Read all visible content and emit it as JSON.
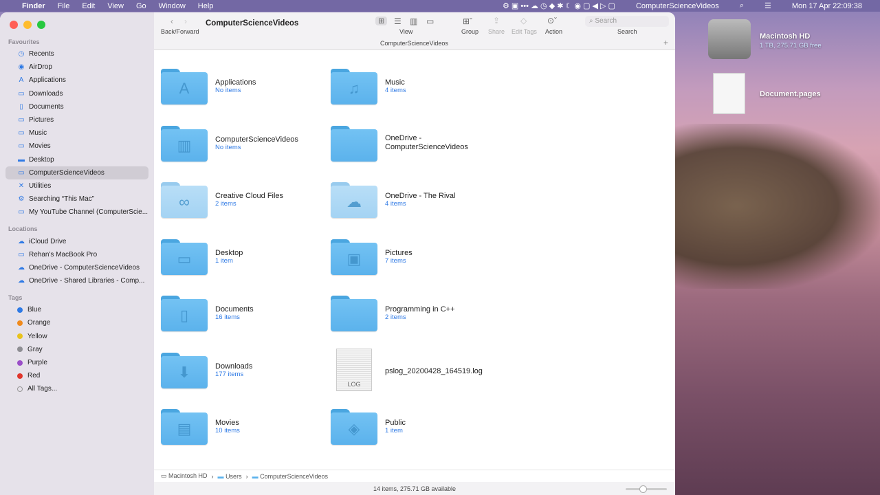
{
  "menubar": {
    "apple": "",
    "app": "Finder",
    "items": [
      "File",
      "Edit",
      "View",
      "Go",
      "Window",
      "Help"
    ],
    "status_title": "ComputerScienceVideos",
    "datetime": "Mon 17 Apr  22:09:38"
  },
  "toolbar": {
    "back_forward": "Back/Forward",
    "title": "ComputerScienceVideos",
    "view": "View",
    "group": "Group",
    "share": "Share",
    "edit_tags": "Edit Tags",
    "action": "Action",
    "search_placeholder": "Search",
    "search": "Search",
    "tab_title": "ComputerScienceVideos",
    "add_tab": "+"
  },
  "sidebar": {
    "favourites_label": "Favourites",
    "favourites": [
      {
        "label": "Recents",
        "icon": "◷"
      },
      {
        "label": "AirDrop",
        "icon": "◉"
      },
      {
        "label": "Applications",
        "icon": "A"
      },
      {
        "label": "Downloads",
        "icon": "▭"
      },
      {
        "label": "Documents",
        "icon": "▯"
      },
      {
        "label": "Pictures",
        "icon": "▭"
      },
      {
        "label": "Music",
        "icon": "▭"
      },
      {
        "label": "Movies",
        "icon": "▭"
      },
      {
        "label": "Desktop",
        "icon": "▬"
      },
      {
        "label": "ComputerScienceVideos",
        "icon": "▭",
        "selected": true
      },
      {
        "label": "Utilities",
        "icon": "✕"
      },
      {
        "label": "Searching “This Mac”",
        "icon": "⚙"
      },
      {
        "label": "My YouTube Channel (ComputerScie...",
        "icon": "▭"
      }
    ],
    "locations_label": "Locations",
    "locations": [
      {
        "label": "iCloud Drive",
        "icon": "☁"
      },
      {
        "label": "Rehan's MacBook Pro",
        "icon": "▭"
      },
      {
        "label": "OneDrive - ComputerScienceVideos",
        "icon": "☁"
      },
      {
        "label": "OneDrive - Shared Libraries - Comp...",
        "icon": "☁"
      }
    ],
    "tags_label": "Tags",
    "tags": [
      {
        "label": "Blue",
        "color": "#2f7ae5"
      },
      {
        "label": "Orange",
        "color": "#f08a1c"
      },
      {
        "label": "Yellow",
        "color": "#e8c21c"
      },
      {
        "label": "Gray",
        "color": "#8e8e93"
      },
      {
        "label": "Purple",
        "color": "#9b4fc8"
      },
      {
        "label": "Red",
        "color": "#e0362c"
      },
      {
        "label": "All Tags...",
        "color": ""
      }
    ]
  },
  "items": [
    {
      "name": "Applications",
      "count": "No items",
      "glyph": "A",
      "kind": "folder"
    },
    {
      "name": "Music",
      "count": "4 items",
      "glyph": "♫",
      "kind": "folder"
    },
    {
      "name": "ComputerScienceVideos",
      "count": "No items",
      "glyph": "▥",
      "kind": "folder"
    },
    {
      "name": "OneDrive - ComputerScienceVideos",
      "count": "",
      "glyph": "",
      "kind": "folder"
    },
    {
      "name": "Creative Cloud Files",
      "count": "2 items",
      "glyph": "∞",
      "kind": "light"
    },
    {
      "name": "OneDrive - The Rival",
      "count": "4 items",
      "glyph": "☁",
      "kind": "light"
    },
    {
      "name": "Desktop",
      "count": "1 item",
      "glyph": "▭",
      "kind": "folder"
    },
    {
      "name": "Pictures",
      "count": "7 items",
      "glyph": "▣",
      "kind": "folder"
    },
    {
      "name": "Documents",
      "count": "16 items",
      "glyph": "▯",
      "kind": "folder"
    },
    {
      "name": "Programming in C++",
      "count": "2 items",
      "glyph": "",
      "kind": "folder"
    },
    {
      "name": "Downloads",
      "count": "177 items",
      "glyph": "⬇",
      "kind": "folder"
    },
    {
      "name": "pslog_20200428_164519.log",
      "count": "",
      "glyph": "LOG",
      "kind": "file"
    },
    {
      "name": "Movies",
      "count": "10 items",
      "glyph": "▤",
      "kind": "folder"
    },
    {
      "name": "Public",
      "count": "1 item",
      "glyph": "◈",
      "kind": "folder"
    }
  ],
  "pathbar": [
    "Macintosh HD",
    "Users",
    "ComputerScienceVideos"
  ],
  "status": "14 items, 275.71 GB available",
  "desktop": {
    "hd_name": "Macintosh HD",
    "hd_info": "1 TB, 275.71 GB free",
    "doc_name": "Document.pages"
  }
}
